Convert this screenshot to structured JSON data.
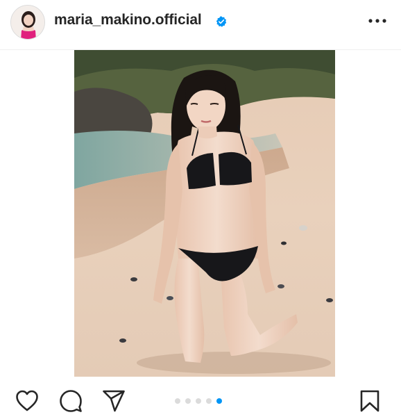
{
  "post": {
    "username": "maria_makino.official",
    "verified": true,
    "verified_icon": "verified-badge-icon",
    "more_icon": "more-options-icon"
  },
  "carousel": {
    "total_slides": 5,
    "active_slide": 5
  },
  "actions": {
    "like_icon": "heart-icon",
    "comment_icon": "comment-icon",
    "share_icon": "share-icon",
    "save_icon": "bookmark-icon"
  },
  "colors": {
    "accent": "#0095f6",
    "text": "#262626",
    "dot_inactive": "#dbdbdb"
  }
}
